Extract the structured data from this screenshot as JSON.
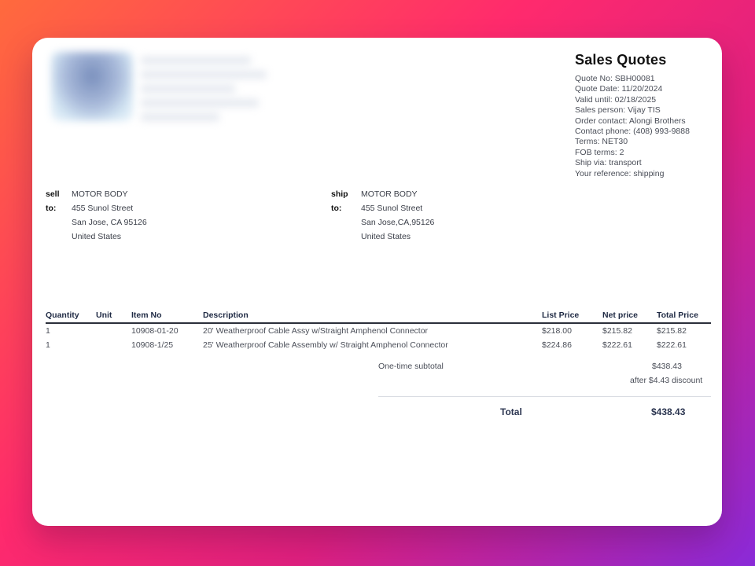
{
  "quote": {
    "title": "Sales Quotes",
    "lines": [
      "Quote No: SBH00081",
      "Quote Date: 11/20/2024",
      "Valid until: 02/18/2025",
      "Sales person: Vijay TIS",
      "Order contact: Alongi Brothers",
      "Contact phone: (408) 993-9888",
      "Terms: NET30",
      "FOB terms: 2",
      "Ship via: transport",
      "Your reference: shipping"
    ]
  },
  "sell_to": {
    "label_1": "sell",
    "label_2": "to:",
    "lines": [
      "MOTOR BODY",
      "455 Sunol Street",
      "San Jose, CA 95126",
      "United States"
    ]
  },
  "ship_to": {
    "label_1": "ship",
    "label_2": "to:",
    "lines": [
      "MOTOR BODY",
      "455 Sunol Street",
      "San Jose,CA,95126",
      "United States"
    ]
  },
  "table": {
    "headers": {
      "qty": "Quantity",
      "unit": "Unit",
      "item": "Item No",
      "desc": "Description",
      "list": "List Price",
      "net": "Net price",
      "total": "Total Price"
    },
    "rows": [
      {
        "qty": "1",
        "unit": "",
        "item": "10908-01-20",
        "desc": "20' Weatherproof Cable Assy w/Straight Amphenol Connector",
        "list": "$218.00",
        "net": "$215.82",
        "total": "$215.82"
      },
      {
        "qty": "1",
        "unit": "",
        "item": "10908-1/25",
        "desc": "25' Weatherproof Cable Assembly w/ Straight Amphenol Connector",
        "list": "$224.86",
        "net": "$222.61",
        "total": "$222.61"
      }
    ]
  },
  "summary": {
    "subtotal_label": "One-time subtotal",
    "subtotal_value": "$438.43",
    "discount_note": "after $4.43 discount",
    "total_label": "Total",
    "total_value": "$438.43"
  }
}
